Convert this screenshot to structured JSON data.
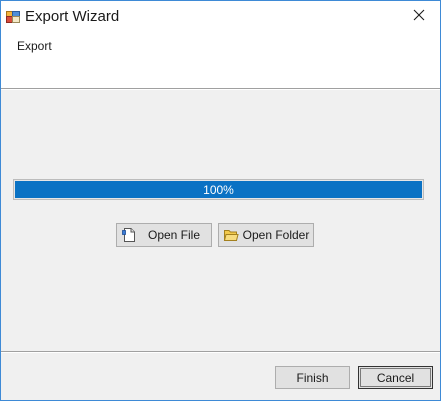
{
  "window": {
    "title": "Export Wizard",
    "app_icon": "app-icon",
    "close_icon": "close-icon"
  },
  "header": {
    "label": "Export"
  },
  "progress": {
    "value": 100,
    "text": "100%",
    "fill_color": "#0a72c4"
  },
  "actions": {
    "open_file_label": "Open File",
    "open_file_icon": "file-icon",
    "open_folder_label": "Open Folder",
    "open_folder_icon": "folder-icon"
  },
  "footer": {
    "finish_label": "Finish",
    "cancel_label": "Cancel"
  }
}
